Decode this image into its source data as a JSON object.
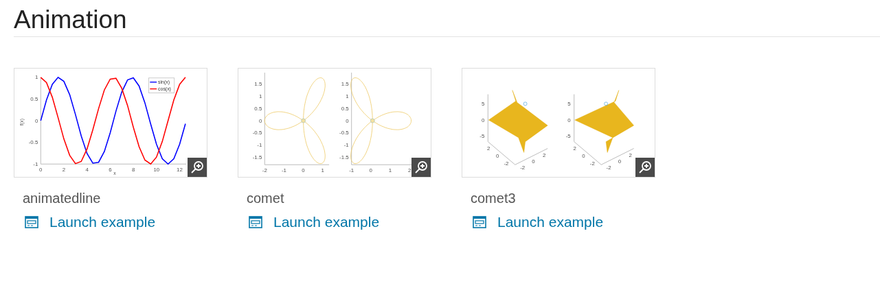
{
  "page_title": "Animation",
  "examples": [
    {
      "kind": "line_plot",
      "name": "animatedline",
      "link": "Launch example",
      "chart_data": {
        "type": "line",
        "xlabel": "x",
        "ylabel": "f(x)",
        "x": [
          0,
          0.5,
          1,
          1.5,
          2,
          2.5,
          3,
          3.5,
          4,
          4.5,
          5,
          5.5,
          6,
          6.5,
          7,
          7.5,
          8,
          8.5,
          9,
          9.5,
          10,
          10.5,
          11,
          11.5,
          12,
          12.5
        ],
        "series": [
          {
            "name": "sin(x)",
            "color": "#0000ff",
            "values": [
              0,
              0.48,
              0.84,
              1,
              0.91,
              0.6,
              0.14,
              -0.35,
              -0.76,
              -0.98,
              -0.96,
              -0.71,
              -0.28,
              0.22,
              0.66,
              0.94,
              0.99,
              0.8,
              0.41,
              -0.08,
              -0.54,
              -0.88,
              -1,
              -0.88,
              -0.54,
              -0.07
            ]
          },
          {
            "name": "cos(x)",
            "color": "#ff0000",
            "values": [
              1,
              0.88,
              0.54,
              0.07,
              -0.42,
              -0.8,
              -0.99,
              -0.94,
              -0.65,
              -0.21,
              0.28,
              0.71,
              0.96,
              0.98,
              0.75,
              0.35,
              -0.15,
              -0.6,
              -0.91,
              -1,
              -0.84,
              -0.48,
              0,
              0.48,
              0.84,
              1
            ]
          }
        ],
        "xlim": [
          0,
          12.6
        ],
        "ylim": [
          -1,
          1
        ],
        "xticks": [
          0,
          2,
          4,
          6,
          8,
          10,
          12
        ],
        "yticks": [
          -1,
          -0.5,
          0,
          0.5,
          1
        ],
        "legend": true
      }
    },
    {
      "kind": "comet",
      "name": "comet",
      "link": "Launch example",
      "panels": [
        {
          "xticks": [
            "-2",
            "-1",
            "0",
            "1"
          ],
          "yticks": [
            "1.5",
            "1",
            "0.5",
            "0",
            "-0.5",
            "-1",
            "-1.5"
          ]
        },
        {
          "xticks": [
            "-1",
            "0",
            "1",
            "2"
          ],
          "yticks": [
            "1.5",
            "1",
            "0.5",
            "0",
            "-0.5",
            "-1",
            "-1.5"
          ]
        }
      ]
    },
    {
      "kind": "surface",
      "name": "comet3",
      "link": "Launch example",
      "panels": [
        {
          "zticks": [
            "5",
            "0",
            "-5"
          ],
          "yticks": [
            "2",
            "0",
            "-2"
          ],
          "xticks": [
            "-2",
            "0",
            "2"
          ]
        },
        {
          "zticks": [
            "5",
            "0",
            "-5"
          ],
          "yticks": [
            "2",
            "0",
            "-2"
          ],
          "xticks": [
            "-2",
            "0",
            "2"
          ]
        }
      ]
    }
  ]
}
